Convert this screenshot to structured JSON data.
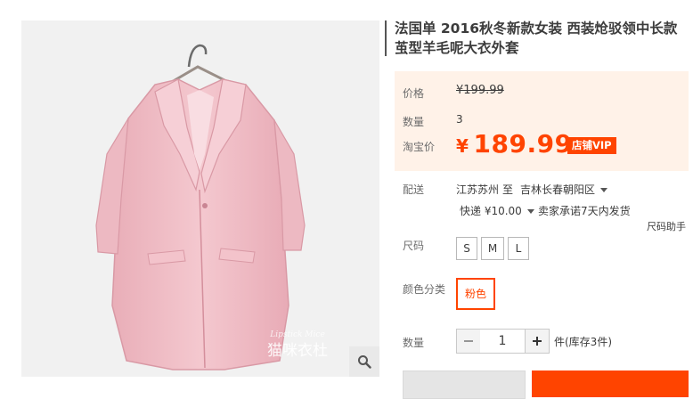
{
  "product": {
    "title": "法国单 2016秋冬新款女装 西装炝驳领中长款茧型羊毛呢大衣外套",
    "watermark": "猫咪衣杜",
    "watermark_sub": "Lipstick Mice"
  },
  "price": {
    "label": "价格",
    "original": "¥199.99",
    "qty_label": "数量",
    "qty_value": "3",
    "promo_label": "淘宝价",
    "promo_currency": "¥",
    "promo_value": "189.99",
    "vip_badge": "店铺VIP"
  },
  "shipping": {
    "label": "配送",
    "from": "江苏苏州",
    "to_word": "至",
    "to": "吉林长春朝阳区",
    "fee": "快递 ¥10.00",
    "promise": "卖家承诺7天内发货"
  },
  "size": {
    "label": "尺码",
    "helper": "尺码助手",
    "options": [
      "S",
      "M",
      "L"
    ]
  },
  "color": {
    "label": "颜色分类",
    "selected": "粉色"
  },
  "quantity": {
    "label": "数量",
    "minus": "−",
    "value": "1",
    "plus": "+",
    "stock": "件(库存3件)"
  },
  "icons": {
    "zoom": "magnifier-icon",
    "dropdown": "caret-down-icon"
  },
  "colors": {
    "accent": "#ff4400",
    "price_bg": "#fff2e8",
    "coat_pink": "#f2c4cb"
  }
}
